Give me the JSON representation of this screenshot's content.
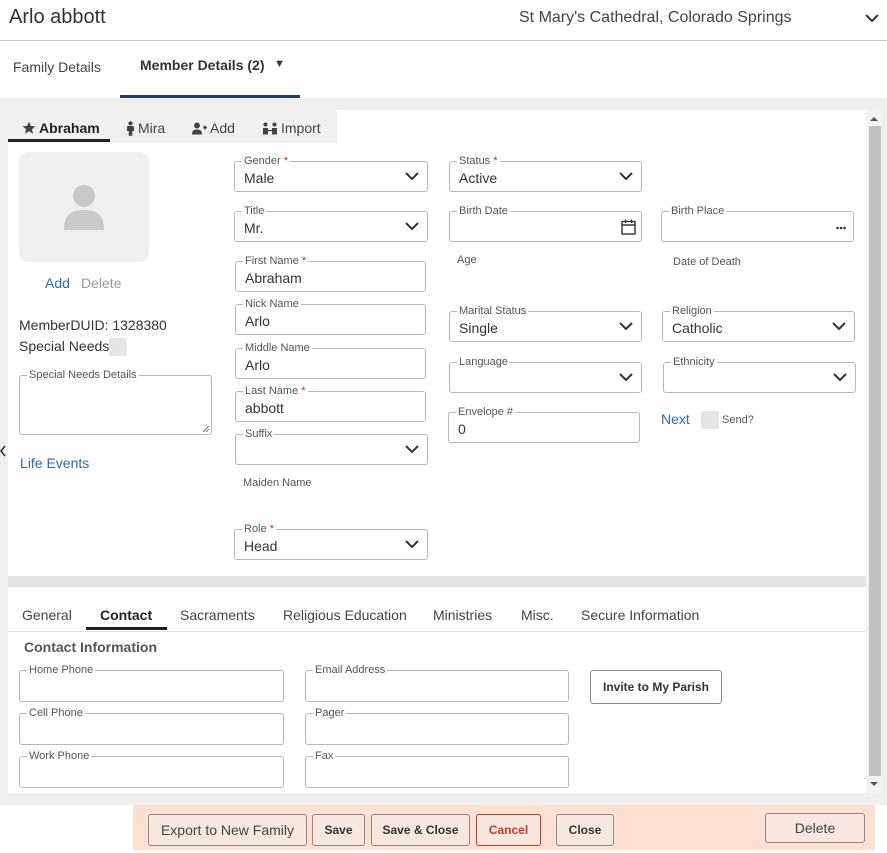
{
  "header": {
    "title": "Arlo abbott",
    "parish": "St Mary's Cathedral, Colorado Springs"
  },
  "page_tabs": {
    "family": "Family Details",
    "member": "Member Details (2)",
    "member_caret": "▼"
  },
  "member_tabs": {
    "abraham": "Abraham",
    "mira": "Mira",
    "add": "Add",
    "import": "Import"
  },
  "photo": {
    "add": "Add",
    "delete": "Delete"
  },
  "member_info": {
    "duid": "MemberDUID: 1328380",
    "special_needs": "Special Needs",
    "special_needs_details_label": "Special Needs Details",
    "life_events": "Life Events"
  },
  "fields": {
    "gender": {
      "label": "Gender",
      "req": "*",
      "value": "Male"
    },
    "title": {
      "label": "Title",
      "value": "Mr."
    },
    "first_name": {
      "label": "First Name",
      "req": "*",
      "value": "Abraham"
    },
    "nick_name": {
      "label": "Nick Name",
      "value": "Arlo"
    },
    "middle_name": {
      "label": "Middle Name",
      "value": "Arlo"
    },
    "last_name": {
      "label": "Last Name",
      "req": "*",
      "value": "abbott"
    },
    "suffix": {
      "label": "Suffix",
      "value": ""
    },
    "maiden_name": {
      "label": "Maiden Name"
    },
    "role": {
      "label": "Role",
      "req": "*",
      "value": "Head"
    },
    "status": {
      "label": "Status",
      "req": "*",
      "value": "Active"
    },
    "birth_date": {
      "label": "Birth Date",
      "value": ""
    },
    "age": {
      "label": "Age"
    },
    "marital_status": {
      "label": "Marital Status",
      "value": "Single"
    },
    "language": {
      "label": "Language",
      "value": ""
    },
    "envelope": {
      "label": "Envelope #",
      "value": "0"
    },
    "birth_place": {
      "label": "Birth Place",
      "value": ""
    },
    "date_of_death": {
      "label": "Date of Death"
    },
    "religion": {
      "label": "Religion",
      "value": "Catholic"
    },
    "ethnicity": {
      "label": "Ethnicity",
      "value": ""
    },
    "next": "Next",
    "send": "Send?"
  },
  "bottom_tabs": [
    "General",
    "Contact",
    "Sacraments",
    "Religious Education",
    "Ministries",
    "Misc.",
    "Secure Information"
  ],
  "contact": {
    "section_title": "Contact Information",
    "home_phone": "Home Phone",
    "cell_phone": "Cell Phone",
    "work_phone": "Work Phone",
    "email": "Email Address",
    "pager": "Pager",
    "fax": "Fax",
    "invite": "Invite to My Parish"
  },
  "footer": {
    "export": "Export to New Family",
    "save": "Save",
    "save_close": "Save & Close",
    "cancel": "Cancel",
    "close": "Close",
    "delete": "Delete"
  },
  "colors": {
    "accent_link": "#2a6ab3",
    "tab_underline": "#1f3a6b",
    "footer_bg": "#fde0d2",
    "cancel_red": "#c0392b",
    "required": "#dd2222"
  },
  "icons": [
    "chevron-down-icon",
    "star-icon",
    "person-icon",
    "add-person-icon",
    "import-icon",
    "avatar-placeholder-icon",
    "calendar-icon",
    "ellipsis-icon",
    "chevron-left-icon",
    "scroll-up-icon",
    "scroll-down-icon"
  ]
}
